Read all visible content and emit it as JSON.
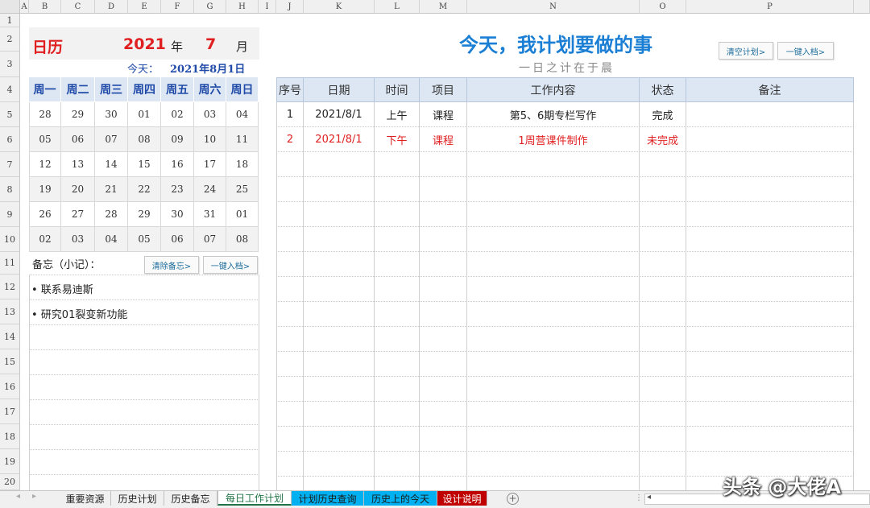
{
  "columns": [
    "A",
    "B",
    "C",
    "D",
    "E",
    "F",
    "G",
    "H",
    "I",
    "J",
    "K",
    "L",
    "M",
    "N",
    "O",
    "P"
  ],
  "rows": [
    "1",
    "2",
    "3",
    "4",
    "5",
    "6",
    "7",
    "8",
    "9",
    "10",
    "11",
    "12",
    "13",
    "14",
    "15",
    "16",
    "17",
    "18",
    "19",
    "20"
  ],
  "calendar": {
    "title": "日历",
    "year": "2021",
    "year_label": "年",
    "month": "7",
    "month_label": "月",
    "today_label": "今天：",
    "today_value": "2021年8月1日",
    "weekdays": [
      "周一",
      "周二",
      "周三",
      "周四",
      "周五",
      "周六",
      "周日"
    ],
    "weeks": [
      [
        "28",
        "29",
        "30",
        "01",
        "02",
        "03",
        "04"
      ],
      [
        "05",
        "06",
        "07",
        "08",
        "09",
        "10",
        "11"
      ],
      [
        "12",
        "13",
        "14",
        "15",
        "16",
        "17",
        "18"
      ],
      [
        "19",
        "20",
        "21",
        "22",
        "23",
        "24",
        "25"
      ],
      [
        "26",
        "27",
        "28",
        "29",
        "30",
        "31",
        "01"
      ],
      [
        "02",
        "03",
        "04",
        "05",
        "06",
        "07",
        "08"
      ]
    ]
  },
  "memo": {
    "label": "备忘（小记）：",
    "clear_button": "清除备忘>",
    "archive_button": "一键入档>",
    "items": [
      "• 联系易迪斯",
      "• 研究01裂变新功能"
    ]
  },
  "plan": {
    "title": "今天，我计划要做的事",
    "subtitle": "一日之计在于晨",
    "clear_button": "清空计划>",
    "archive_button": "一键入档>",
    "headers": [
      "序号",
      "日期",
      "时间",
      "项目",
      "工作内容",
      "状态",
      "备注"
    ],
    "rows": [
      {
        "no": "1",
        "date": "2021/8/1",
        "time": "上午",
        "project": "课程",
        "content": "第5、6期专栏写作",
        "status": "完成",
        "note": "",
        "color": "#222222"
      },
      {
        "no": "2",
        "date": "2021/8/1",
        "time": "下午",
        "project": "课程",
        "content": "1周营课件制作",
        "status": "未完成",
        "note": "",
        "color": "#e02020"
      }
    ]
  },
  "sheet_tabs": [
    {
      "label": "重要资源",
      "bg": "#f0f0f0",
      "color": "#222222"
    },
    {
      "label": "历史计划",
      "bg": "#f0f0f0",
      "color": "#222222"
    },
    {
      "label": "历史备忘",
      "bg": "#f0f0f0",
      "color": "#222222"
    },
    {
      "label": "每日工作计划",
      "bg": "#ffffff",
      "color": "#217346"
    },
    {
      "label": "计划历史查询",
      "bg": "#00b0f0",
      "color": "#1a1a1a"
    },
    {
      "label": "历史上的今天",
      "bg": "#00b0f0",
      "color": "#1a1a1a"
    },
    {
      "label": "设计说明",
      "bg": "#c00000",
      "color": "#ffffff"
    }
  ],
  "watermark": "头条 @大佬A",
  "colors": {
    "accent_blue": "#1a7fd4",
    "red": "#e02020",
    "header_bg": "#dde6f3",
    "active_tab_text": "#217346"
  }
}
